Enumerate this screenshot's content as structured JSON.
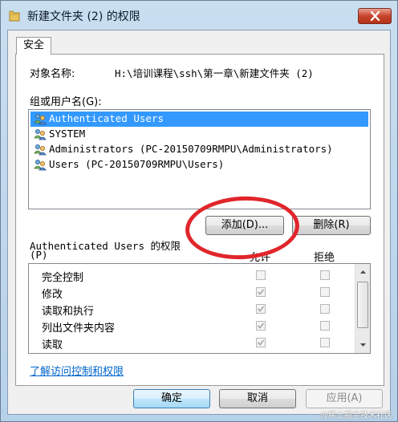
{
  "window": {
    "title": "新建文件夹 (2) 的权限",
    "close_icon": "close-icon"
  },
  "tabs": [
    {
      "label": "安全",
      "selected": true
    }
  ],
  "object": {
    "label": "对象名称:",
    "value": "H:\\培训课程\\ssh\\第一章\\新建文件夹 (2)"
  },
  "groups": {
    "label": "组或用户名(G):",
    "items": [
      {
        "name": "Authenticated Users",
        "selected": true
      },
      {
        "name": "SYSTEM",
        "selected": false
      },
      {
        "name": "Administrators (PC-20150709RMPU\\Administrators)",
        "selected": false
      },
      {
        "name": "Users (PC-20150709RMPU\\Users)",
        "selected": false
      }
    ]
  },
  "buttons": {
    "add": "添加(D)...",
    "remove": "删除(R)",
    "ok": "确定",
    "cancel": "取消",
    "apply": "应用(A)"
  },
  "permissions": {
    "header_line1": "Authenticated Users 的权限",
    "header_line2": "(P)",
    "allow": "允许",
    "deny": "拒绝",
    "rows": [
      {
        "name": "完全控制",
        "allow": false,
        "deny": false
      },
      {
        "name": "修改",
        "allow": true,
        "deny": false
      },
      {
        "name": "读取和执行",
        "allow": true,
        "deny": false
      },
      {
        "name": "列出文件夹内容",
        "allow": true,
        "deny": false
      },
      {
        "name": "读取",
        "allow": true,
        "deny": false
      }
    ]
  },
  "link": "了解访问控制和权限",
  "watermark": "@稀土掘金技术社区"
}
